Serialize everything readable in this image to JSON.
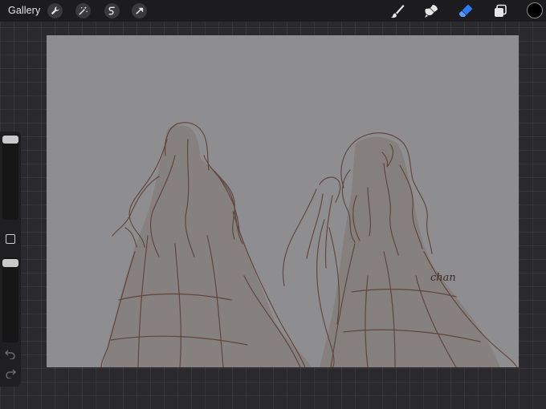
{
  "topbar": {
    "gallery_label": "Gallery",
    "left_tools": [
      "wrench-icon",
      "magic-wand-icon",
      "selection-icon",
      "transform-arrow-icon"
    ],
    "right_tools": [
      "brush-icon",
      "smudge-icon",
      "eraser-icon",
      "layers-icon"
    ],
    "active_tool": "eraser-icon",
    "active_color": "#000000",
    "accent_color": "#2f7bf5"
  },
  "sidebar": {
    "controls": [
      "brush-size-slider",
      "modify-button",
      "opacity-slider",
      "undo-icon",
      "redo-icon"
    ]
  },
  "canvas": {
    "background": "#8e8e90",
    "stroke_color": "#5a3d32",
    "signature_text": "chan"
  }
}
